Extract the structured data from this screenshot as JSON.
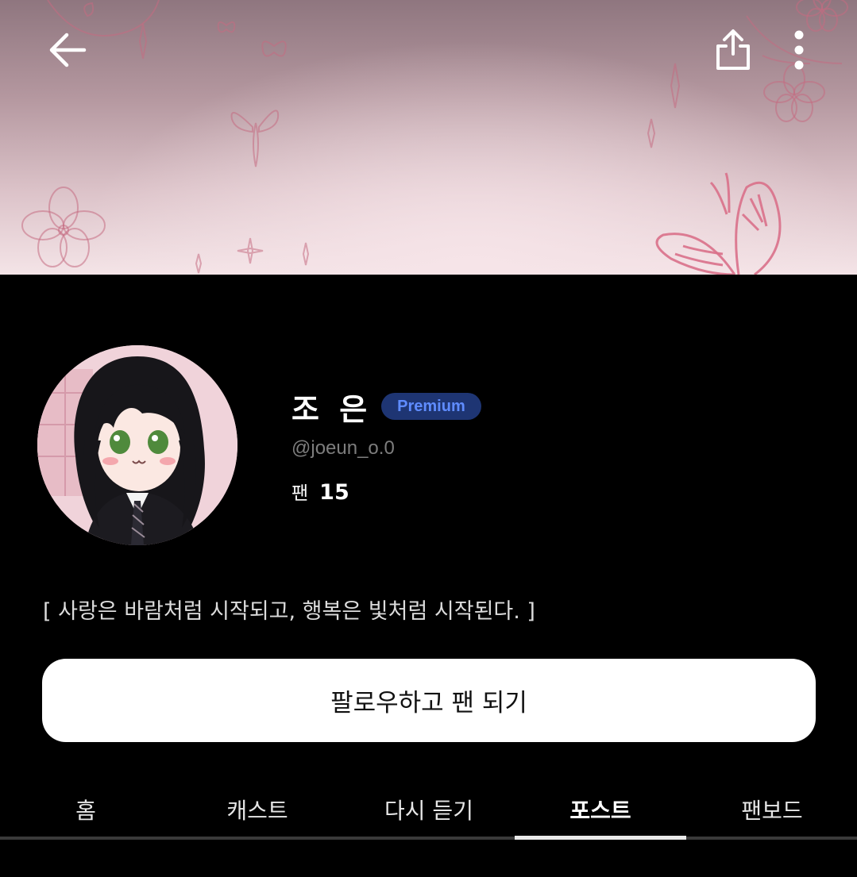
{
  "header": {
    "back_icon": "arrow-left-icon",
    "share_icon": "share-upload-icon",
    "more_icon": "more-vertical-icon"
  },
  "profile": {
    "name": "조 은",
    "badge": "Premium",
    "handle": "@joeun_o.0",
    "fans_label": "팬",
    "fans_count": "15",
    "bio": "[ 사랑은 바람처럼 시작되고, 행복은 빛처럼 시작된다. ]"
  },
  "actions": {
    "follow_label": "팔로우하고 팬 되기"
  },
  "tabs": [
    {
      "label": "홈"
    },
    {
      "label": "캐스트"
    },
    {
      "label": "다시 듣기"
    },
    {
      "label": "포스트",
      "active": true
    },
    {
      "label": "팬보드"
    }
  ],
  "colors": {
    "background": "#000000",
    "badge_bg": "#1e3573",
    "badge_text": "#5f8cff",
    "button_bg": "#ffffff"
  }
}
